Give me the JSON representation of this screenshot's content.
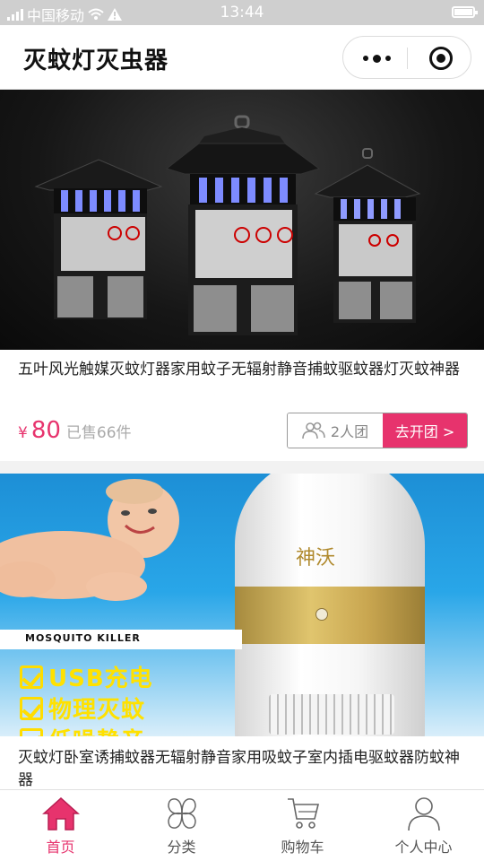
{
  "status_bar": {
    "carrier": "中国移动",
    "time": "13:44"
  },
  "nav": {
    "title": "灭蚊灯灭虫器"
  },
  "products": [
    {
      "title": "五叶风光触媒灭蚊灯器家用蚊子无辐射静音捕蚊驱蚊器灯灭蚊神器",
      "currency": "¥",
      "price": "80",
      "sold": "已售66件",
      "group_size": "2人团",
      "group_action": "去开团 >"
    },
    {
      "title": "灭蚊灯卧室诱捕蚊器无辐射静音家用吸蚊子室内插电驱蚊器防蚊神器",
      "image_banner": "MOSQUITO  KILLER",
      "image_features": [
        "USB充电",
        "物理灭蚊",
        "低噪静音"
      ],
      "image_calligraphy": "神沃"
    }
  ],
  "tabbar": {
    "items": [
      {
        "label": "首页",
        "icon": "home-icon",
        "active": true
      },
      {
        "label": "分类",
        "icon": "category-icon",
        "active": false
      },
      {
        "label": "购物车",
        "icon": "cart-icon",
        "active": false
      },
      {
        "label": "个人中心",
        "icon": "user-icon",
        "active": false
      }
    ]
  },
  "colors": {
    "accent": "#e7336d",
    "status_bar_bg": "#cfcfcf"
  }
}
